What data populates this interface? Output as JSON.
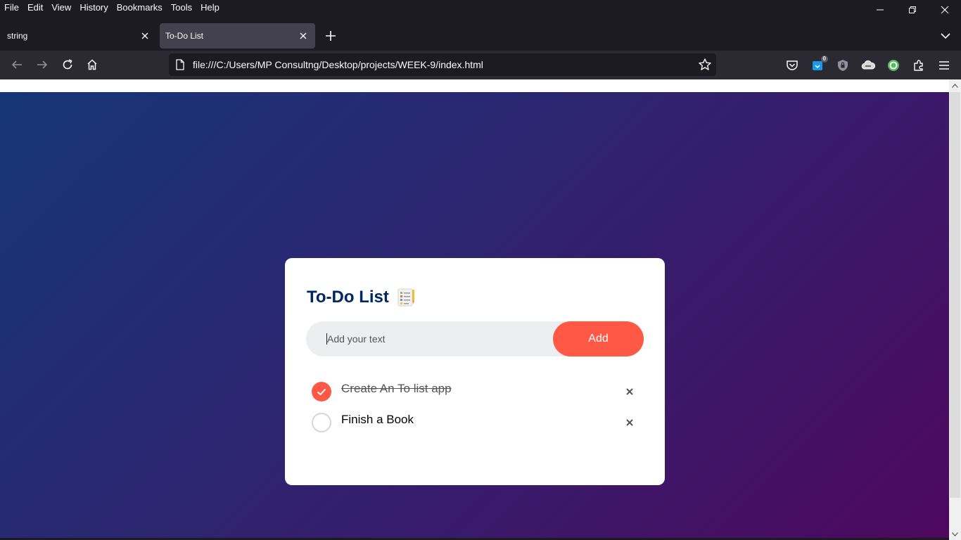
{
  "menu": [
    "File",
    "Edit",
    "View",
    "History",
    "Bookmarks",
    "Tools",
    "Help"
  ],
  "tabs": [
    {
      "title": "string",
      "active": false
    },
    {
      "title": "To-Do List",
      "active": true
    }
  ],
  "urlbar": {
    "url": "file:///C:/Users/MP Consultng/Desktop/projects/WEEK-9/index.html"
  },
  "toolbar": {
    "extension_badge": "0"
  },
  "app": {
    "title": "To-Do List",
    "input_placeholder": "Add your text",
    "add_label": "Add",
    "tasks": [
      {
        "text": "Create An To list app",
        "checked": true
      },
      {
        "text": "Finish a Book",
        "checked": false
      }
    ]
  },
  "colors": {
    "accent": "#ff5945",
    "title": "#002765",
    "gradient_start": "#153677",
    "gradient_end": "#4e085f"
  },
  "icons": [
    "back-icon",
    "forward-icon",
    "reload-icon",
    "home-icon",
    "page-icon",
    "star-icon",
    "pocket-icon",
    "extension-icon",
    "shield-icon",
    "cloud-icon",
    "sync-icon",
    "extensions-icon",
    "menu-icon",
    "checklist-icon",
    "checkmark-icon",
    "close-icon"
  ]
}
